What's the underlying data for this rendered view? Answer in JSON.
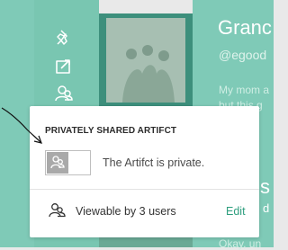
{
  "background": {
    "title_partial": "Granc",
    "handle_partial": "@egood",
    "description_line1": "My mom a",
    "description_line2": "but this g",
    "peek_heading_char": "s",
    "peek_text_char": "d",
    "peek_bottom": "Okay, un",
    "sidebar_icons": [
      "pin-icon",
      "share-icon",
      "users-icon"
    ],
    "accent_color": "#7fcab7"
  },
  "popup": {
    "title": "PRIVATELY SHARED ARTIFCT",
    "toggle_state": "off",
    "private_label": "The Artifct is private.",
    "viewable_label": "Viewable by 3 users",
    "edit_label": "Edit",
    "edit_color": "#2e9e7e"
  }
}
